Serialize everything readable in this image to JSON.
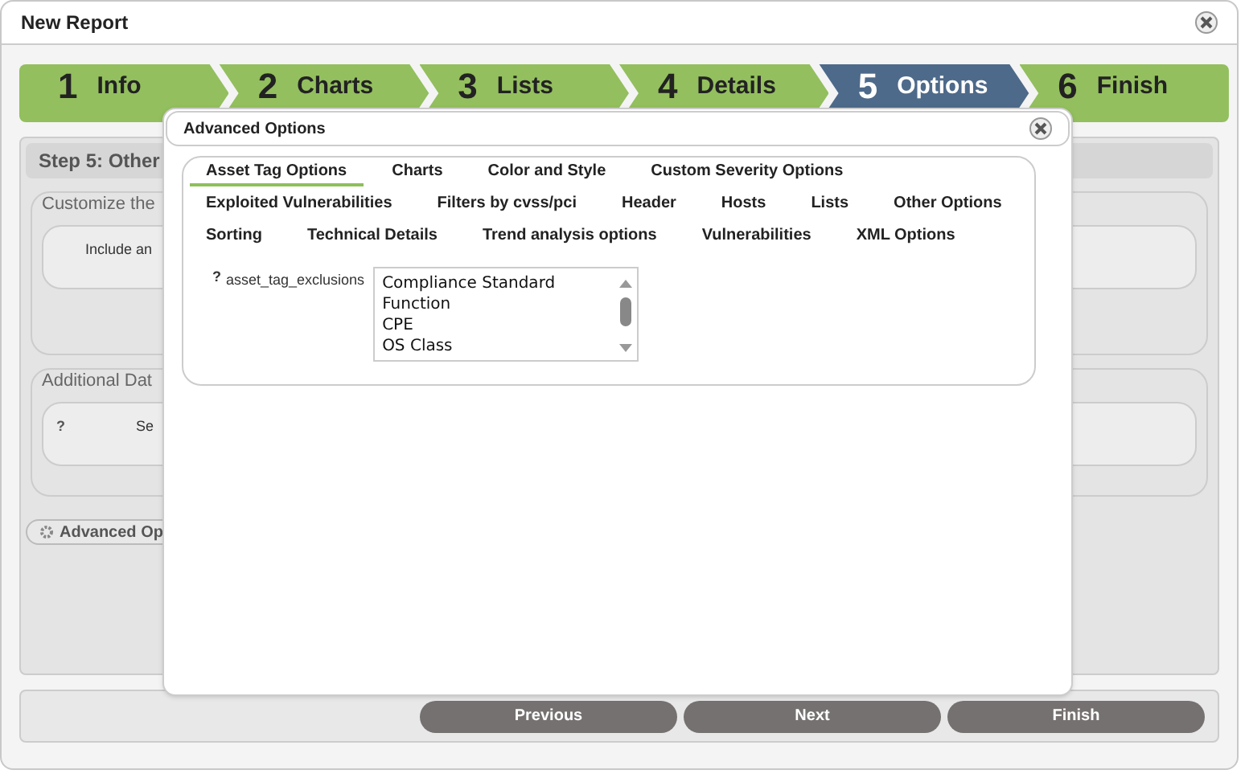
{
  "window": {
    "title": "New Report"
  },
  "steps": [
    {
      "number": "1",
      "label": "Info",
      "selected": false
    },
    {
      "number": "2",
      "label": "Charts",
      "selected": false
    },
    {
      "number": "3",
      "label": "Lists",
      "selected": false
    },
    {
      "number": "4",
      "label": "Details",
      "selected": false
    },
    {
      "number": "5",
      "label": "Options",
      "selected": true
    },
    {
      "number": "6",
      "label": "Finish",
      "selected": false
    }
  ],
  "panel": {
    "title": "Step 5: Other",
    "sections": [
      {
        "legend": "Customize the",
        "item_label": "Include an"
      },
      {
        "legend": "Additional Dat",
        "help": "?",
        "item_label": "Se"
      }
    ],
    "advanced_button": "Advanced Op"
  },
  "footer_buttons": [
    "Previous",
    "Next",
    "Finish"
  ],
  "dialog": {
    "title": "Advanced Options",
    "tab_rows": [
      [
        {
          "label": "Asset Tag Options",
          "selected": true
        },
        {
          "label": "Charts",
          "selected": false
        },
        {
          "label": "Color and Style",
          "selected": false
        },
        {
          "label": "Custom Severity Options",
          "selected": false
        }
      ],
      [
        {
          "label": "Exploited Vulnerabilities",
          "selected": false
        },
        {
          "label": "Filters by cvss/pci",
          "selected": false
        },
        {
          "label": "Header",
          "selected": false
        },
        {
          "label": "Hosts",
          "selected": false
        },
        {
          "label": "Lists",
          "selected": false
        },
        {
          "label": "Other Options",
          "selected": false
        }
      ],
      [
        {
          "label": "Sorting",
          "selected": false
        },
        {
          "label": "Technical Details",
          "selected": false
        },
        {
          "label": "Trend analysis options",
          "selected": false
        },
        {
          "label": "Vulnerabilities",
          "selected": false
        },
        {
          "label": "XML Options",
          "selected": false
        }
      ]
    ],
    "field": {
      "help": "?",
      "label": "asset_tag_exclusions",
      "options": [
        "Compliance Standard",
        "Function",
        "CPE",
        "OS Class"
      ]
    }
  }
}
